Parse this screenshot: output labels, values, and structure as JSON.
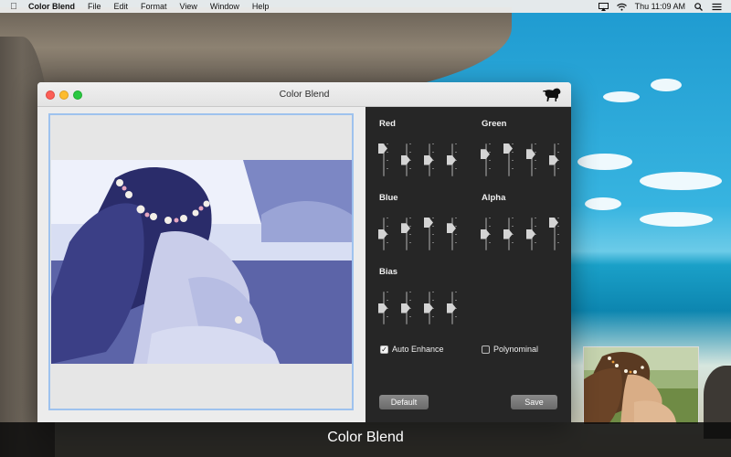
{
  "menubar": {
    "app_name": "Color Blend",
    "items": [
      "File",
      "Edit",
      "Format",
      "View",
      "Window",
      "Help"
    ],
    "clock": "Thu 11:09 AM",
    "status_icons": [
      "airplay-icon",
      "wifi-icon",
      "spotlight-search-icon",
      "notification-center-icon"
    ]
  },
  "window": {
    "title": "Color Blend",
    "controls": [
      "close",
      "minimize",
      "maximize"
    ],
    "brand_icon": "lion-icon"
  },
  "panel": {
    "groups": [
      {
        "label": "Red",
        "levels": [
          0.0,
          0.5,
          0.5,
          0.5
        ]
      },
      {
        "label": "Green",
        "levels": [
          0.25,
          0.0,
          0.25,
          0.5
        ]
      },
      {
        "label": "Blue",
        "levels": [
          0.5,
          0.25,
          0.0,
          0.25
        ]
      },
      {
        "label": "Alpha",
        "levels": [
          0.5,
          0.5,
          0.5,
          0.0
        ]
      },
      {
        "label": "Bias",
        "levels": [
          0.5,
          0.5,
          0.5,
          0.5
        ]
      }
    ],
    "auto_enhance": {
      "label": "Auto Enhance",
      "checked": true
    },
    "polynominal": {
      "label": "Polynominal",
      "checked": false
    },
    "default_button": "Default",
    "save_button": "Save"
  },
  "caption": "Color Blend",
  "colors": {
    "panel_bg": "#262626",
    "preview_border": "#9ec2ee",
    "photo_tint": "#6f7ec0"
  }
}
